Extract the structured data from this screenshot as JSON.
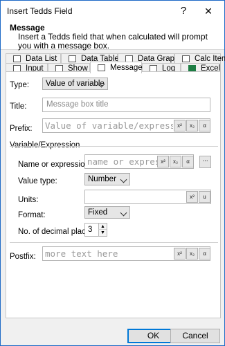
{
  "window": {
    "title": "Insert Tedds Field",
    "help_glyph": "?",
    "close_glyph": "✕"
  },
  "header": {
    "title": "Message",
    "description": "Insert a Tedds field that when calculated will prompt you with a message box."
  },
  "tabs_row1": [
    {
      "label": "Data List",
      "icon": "data-list-icon"
    },
    {
      "label": "Data Table",
      "icon": "data-table-icon"
    },
    {
      "label": "Data Graph",
      "icon": "data-graph-icon"
    },
    {
      "label": "Calc Item",
      "icon": "calc-item-icon"
    }
  ],
  "tabs_row2": [
    {
      "label": "Input",
      "icon": "input-icon"
    },
    {
      "label": "Show",
      "icon": "show-icon"
    },
    {
      "label": "Message",
      "icon": "message-icon",
      "active": true
    },
    {
      "label": "Log",
      "icon": "log-icon"
    },
    {
      "label": "Excel",
      "icon": "excel-icon"
    }
  ],
  "form": {
    "type_label": "Type:",
    "type_value": "Value of variable",
    "title_label": "Title:",
    "title_placeholder": "Message box title",
    "prefix_label": "Prefix:",
    "prefix_placeholder": "Value of variable/expression",
    "section_label": "Variable/Expression",
    "name_label": "Name or expression:",
    "name_placeholder": "name or expression",
    "value_type_label": "Value type:",
    "value_type_value": "Number",
    "units_label": "Units:",
    "units_value": "",
    "format_label": "Format:",
    "format_value": "Fixed",
    "decimals_label": "No. of decimal places:",
    "decimals_value": "3",
    "postfix_label": "Postfix:",
    "postfix_placeholder": "more text here"
  },
  "format_buttons": {
    "superscript": "x²",
    "subscript": "x₂",
    "alpha": "α",
    "units": "u",
    "browse": "..."
  },
  "footer": {
    "ok": "OK",
    "cancel": "Cancel"
  }
}
